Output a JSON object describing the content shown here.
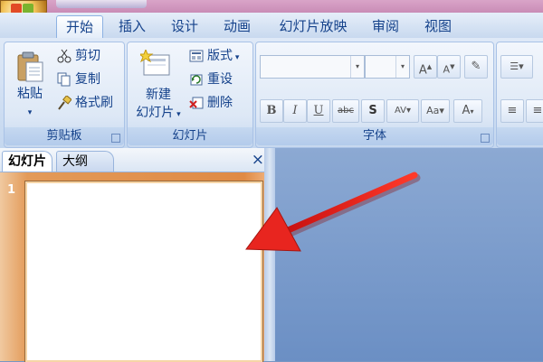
{
  "tabs": [
    {
      "label": "开始",
      "active": true
    },
    {
      "label": "插入"
    },
    {
      "label": "设计"
    },
    {
      "label": "动画"
    },
    {
      "label": "幻灯片放映"
    },
    {
      "label": "审阅"
    },
    {
      "label": "视图"
    }
  ],
  "clipboard": {
    "paste": "粘贴",
    "cut": "剪切",
    "copy": "复制",
    "format_painter": "格式刷",
    "group_label": "剪贴板"
  },
  "slides_group": {
    "new_slide_line1": "新建",
    "new_slide_line2": "幻灯片",
    "layout": "版式",
    "reset": "重设",
    "delete": "删除",
    "group_label": "幻灯片"
  },
  "font_group": {
    "group_label": "字体",
    "font_name_value": "",
    "font_size_value": "",
    "bold": "B",
    "italic": "I",
    "underline": "U",
    "strike": "abc",
    "shadow": "S",
    "spacing": "AV",
    "case": "Aa",
    "color": "A"
  },
  "pane": {
    "tab_slides": "幻灯片",
    "tab_outline": "大纲",
    "close": "×",
    "slide_number": "1"
  },
  "colors": {
    "accent": "#15428b",
    "ribbon": "#dfe9f7",
    "annotation_arrow": "#e8251f"
  },
  "icons": [
    "office-button-icon",
    "paste-icon",
    "cut-icon",
    "copy-icon",
    "format-painter-icon",
    "new-slide-icon",
    "layout-icon",
    "reset-icon",
    "delete-icon",
    "grow-font-icon",
    "shrink-font-icon",
    "clear-format-icon",
    "bullets-icon",
    "align-left-icon",
    "close-pane-icon"
  ]
}
